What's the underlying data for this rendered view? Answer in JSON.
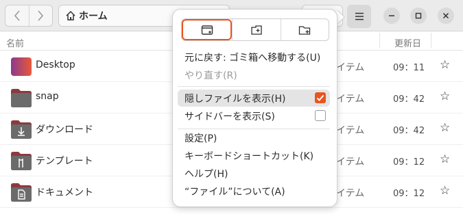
{
  "header": {
    "location": "ホーム",
    "icons": {
      "back": "chevron-left-icon",
      "forward": "chevron-right-icon",
      "home": "home-icon",
      "menu": "hamburger-menu-icon"
    }
  },
  "columns": {
    "name": "名前",
    "modified": "更新日"
  },
  "files": [
    {
      "name": "Desktop",
      "size": "イテム",
      "time": "09：11",
      "star": "☆",
      "icon": "desktop-folder-icon"
    },
    {
      "name": "snap",
      "size": "イテム",
      "time": "09：42",
      "star": "☆",
      "icon": "folder-icon"
    },
    {
      "name": "ダウンロード",
      "size": "イテム",
      "time": "09：42",
      "star": "☆",
      "icon": "download-folder-icon"
    },
    {
      "name": "テンプレート",
      "size": "イテム",
      "time": "09：12",
      "star": "☆",
      "icon": "templates-folder-icon"
    },
    {
      "name": "ドキュメント",
      "size": "イテム",
      "time": "09：12",
      "star": "☆",
      "icon": "documents-folder-icon"
    }
  ],
  "menu": {
    "undo": "元に戻す: ゴミ箱へ移動する(U)",
    "redo": "やり直す(R)",
    "show_hidden": "隠しファイルを表示(H)",
    "show_hidden_checked": true,
    "show_sidebar": "サイドバーを表示(S)",
    "show_sidebar_checked": false,
    "settings": "設定(P)",
    "shortcuts": "キーボードショートカット(K)",
    "help": "ヘルプ(H)",
    "about": "“ファイル”について(A)"
  },
  "colors": {
    "accent": "#e95420"
  }
}
